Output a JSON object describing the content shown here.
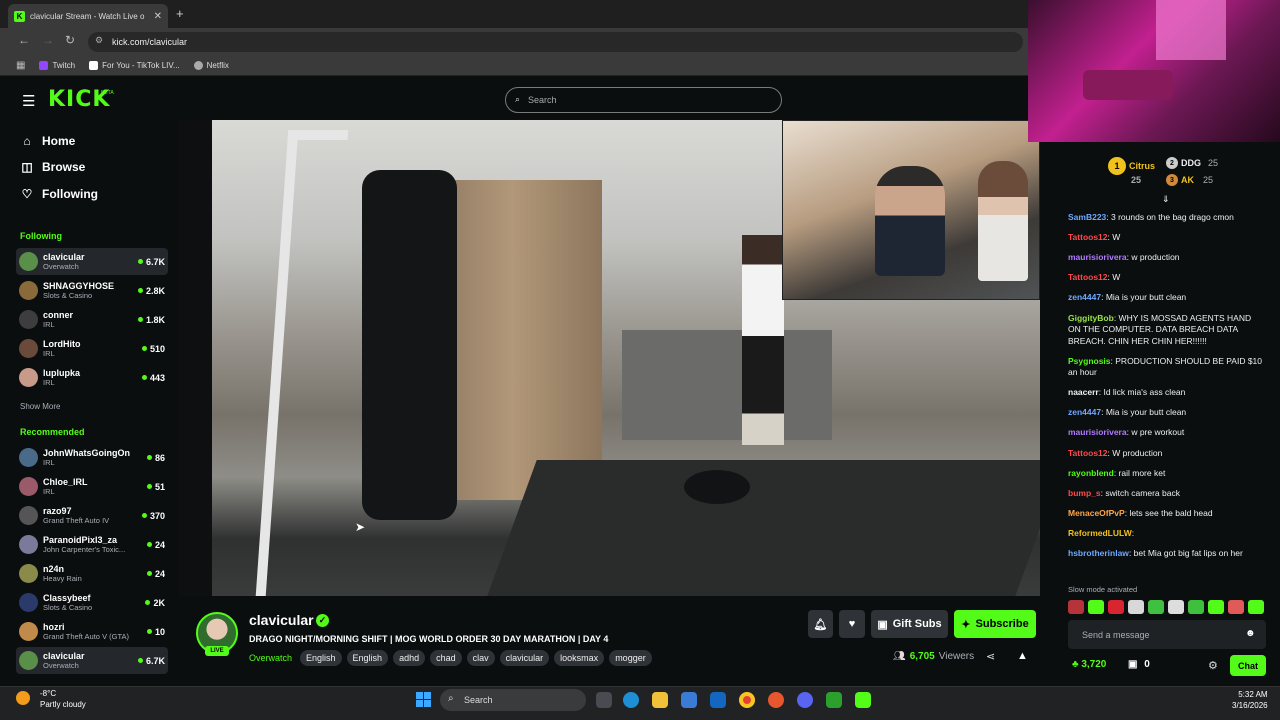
{
  "browser": {
    "tab_title": "clavicular Stream - Watch Live o",
    "tab_close": "✕",
    "new_tab": "+",
    "url": "kick.com/clavicular",
    "bookmarks": [
      {
        "label": "Twitch",
        "color": "#9146ff"
      },
      {
        "label": "For You - TikTok LIV...",
        "color": "#ffffff"
      },
      {
        "label": "Netflix",
        "color": "#aaaaaa"
      }
    ]
  },
  "kick": {
    "logo": "KICK",
    "beta": "BETA",
    "search_placeholder": "Search",
    "brand_color": "#53fc18"
  },
  "sidebar": {
    "nav": [
      {
        "label": "Home",
        "icon": "home-icon",
        "glyph": "⌂"
      },
      {
        "label": "Browse",
        "icon": "browse-icon",
        "glyph": "◫"
      },
      {
        "label": "Following",
        "icon": "heart-icon",
        "glyph": "♡"
      }
    ],
    "following_header": "Following",
    "following": [
      {
        "name": "clavicular",
        "category": "Overwatch",
        "viewers": "6.7K",
        "color": "#5a8f4a"
      },
      {
        "name": "SHNAGGYHOSE",
        "category": "Slots & Casino",
        "viewers": "2.8K",
        "color": "#8a6a3a"
      },
      {
        "name": "conner",
        "category": "IRL",
        "viewers": "1.8K",
        "color": "#3d3d3d"
      },
      {
        "name": "LordHito",
        "category": "IRL",
        "viewers": "510",
        "color": "#6a4a3a"
      },
      {
        "name": "luplupka",
        "category": "IRL",
        "viewers": "443",
        "color": "#c89a8a"
      }
    ],
    "show_more": "Show More",
    "recommended_header": "Recommended",
    "recommended": [
      {
        "name": "JohnWhatsGoingOn",
        "category": "IRL",
        "viewers": "86",
        "color": "#4a6a8a"
      },
      {
        "name": "Chloe_IRL",
        "category": "IRL",
        "viewers": "51",
        "color": "#9a5a6a"
      },
      {
        "name": "razo97",
        "category": "Grand Theft Auto IV",
        "viewers": "370",
        "color": "#555555"
      },
      {
        "name": "ParanoidPixl3_za",
        "category": "John Carpenter's Toxic...",
        "viewers": "24",
        "color": "#7a7a9a"
      },
      {
        "name": "n24n",
        "category": "Heavy Rain",
        "viewers": "24",
        "color": "#8a8a4a"
      },
      {
        "name": "Classybeef",
        "category": "Slots & Casino",
        "viewers": "2K",
        "color": "#2a3a6a"
      },
      {
        "name": "hozri",
        "category": "Grand Theft Auto V (GTA)",
        "viewers": "10",
        "color": "#c08a4a"
      },
      {
        "name": "clavicular",
        "category": "Overwatch",
        "viewers": "6.7K",
        "color": "#5a8f4a"
      }
    ]
  },
  "stream": {
    "channel": "clavicular",
    "verified": "✓",
    "live_badge": "LIVE",
    "title": "DRAGO NIGHT/MORNING SHIFT | MOG WORLD ORDER 30 DAY MARATHON | DAY 4",
    "category": "Overwatch",
    "tags": [
      "English",
      "English",
      "adhd",
      "chad",
      "clav",
      "clavicular",
      "looksmax",
      "mogger"
    ],
    "gift_subs": "Gift Subs",
    "subscribe": "Subscribe",
    "viewers_count": "6,705",
    "viewers_label": "Viewers"
  },
  "chat": {
    "leaderboard": [
      {
        "name": "Citrus",
        "amount": "25",
        "color": "#f1c21b"
      },
      {
        "name": "DDG",
        "amount": "25",
        "color": "#ffffff"
      },
      {
        "name": "AK",
        "amount": "25",
        "color": "#f1c21b"
      }
    ],
    "messages": [
      {
        "user": "SamB223",
        "text": "3 rounds on the bag drago cmon",
        "color": "#6fa8ff"
      },
      {
        "user": "Tattoos12",
        "text": "W",
        "color": "#ff4a4a"
      },
      {
        "user": "maurisiorivera",
        "text": "w production",
        "color": "#b07bff"
      },
      {
        "user": "Tattoos12",
        "text": "W",
        "color": "#ff4a4a"
      },
      {
        "user": "zen4447",
        "text": "Mia is your butt clean",
        "color": "#6fa8ff"
      },
      {
        "user": "GiggityBob",
        "text": "WHY IS MOSSAD AGENTS HAND ON THE COMPUTER. DATA BREACH DATA BREACH. CHIN HER CHIN HER!!!!!!",
        "color": "#9be34a"
      },
      {
        "user": "Psygnosis",
        "text": "PRODUCTION SHOULD BE PAID $10 an hour",
        "color": "#53fc18"
      },
      {
        "user": "naacerr",
        "text": "Id lick mia's ass clean",
        "color": "#efeff1"
      },
      {
        "user": "zen4447",
        "text": "Mia is your butt clean",
        "color": "#6fa8ff"
      },
      {
        "user": "maurisiorivera",
        "text": "w pre workout",
        "color": "#b07bff"
      },
      {
        "user": "Tattoos12",
        "text": "W production",
        "color": "#ff4a4a"
      },
      {
        "user": "rayonblend",
        "text": "rail more ket",
        "color": "#53fc18"
      },
      {
        "user": "bump_s",
        "text": "switch camera back",
        "color": "#ff4a4a"
      },
      {
        "user": "MenaceOfPvP",
        "text": "lets see the bald head",
        "color": "#ffa54a"
      },
      {
        "user": "ReformedLULW",
        "text": "",
        "color": "#f1c21b"
      },
      {
        "user": "hsbrotherinlaw",
        "text": "bet Mia got big fat lips on her",
        "color": "#6fa8ff"
      }
    ],
    "slow_mode": "Slow mode activated",
    "input_placeholder": "Send a message",
    "kicks": "3,720",
    "gifts": "0",
    "chat_button": "Chat"
  },
  "taskbar": {
    "temp": "-8°C",
    "weather": "Partly cloudy",
    "search": "Search",
    "time": "5:32 AM",
    "date": "3/16/2026"
  }
}
